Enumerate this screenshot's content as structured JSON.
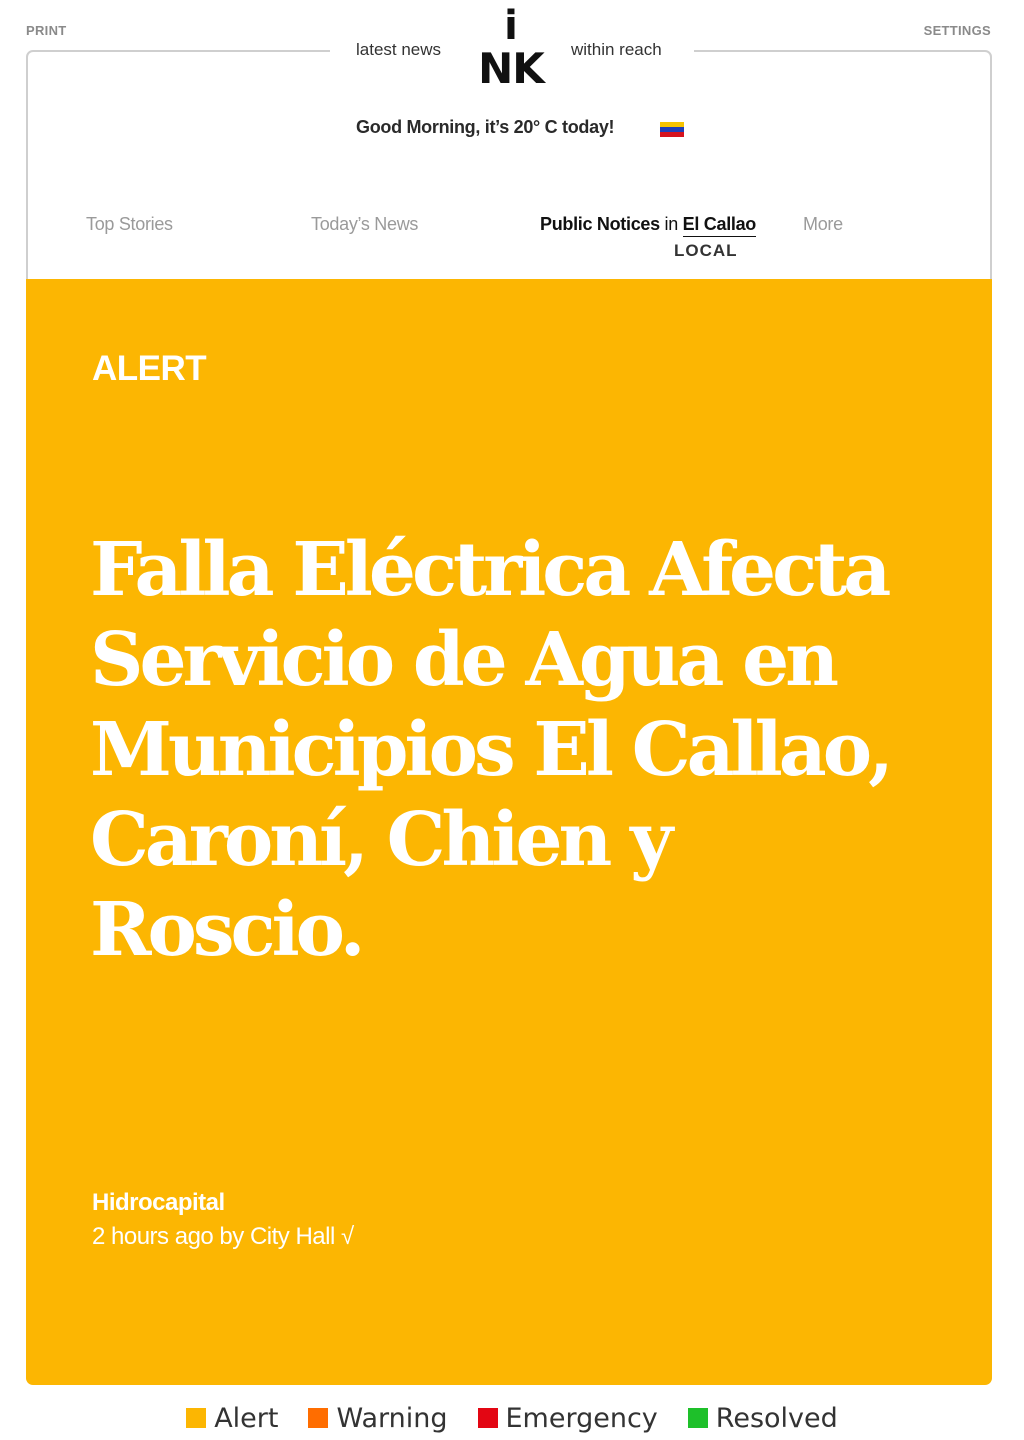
{
  "header": {
    "print_label": "PRINT",
    "settings_label": "SETTINGS",
    "tagline_left": "latest news",
    "tagline_right": "within reach",
    "logo_i": "i",
    "logo_nk": "NK",
    "greeting": "Good Morning, it’s 20° C today!",
    "flag_icon": "venezuela-flag"
  },
  "nav": {
    "top_stories": "Top Stories",
    "todays_news": "Today’s News",
    "public_notices": "Public Notices",
    "in_word": "in",
    "location": "El Callao",
    "local_label": "LOCAL",
    "more": "More"
  },
  "article": {
    "category": "ALERT",
    "headline": "Falla Eléctrica Afecta Servicio de Agua en Municipios El Callao, Caroní, Chien y Roscio.",
    "source": "Hidrocapital",
    "byline": "2 hours ago by City Hall √",
    "background_color": "#fcb602"
  },
  "legend": [
    {
      "label": "Alert",
      "color": "#fcb602"
    },
    {
      "label": "Warning",
      "color": "#ff6d00"
    },
    {
      "label": "Emergency",
      "color": "#e30613"
    },
    {
      "label": "Resolved",
      "color": "#1ec02a"
    }
  ]
}
